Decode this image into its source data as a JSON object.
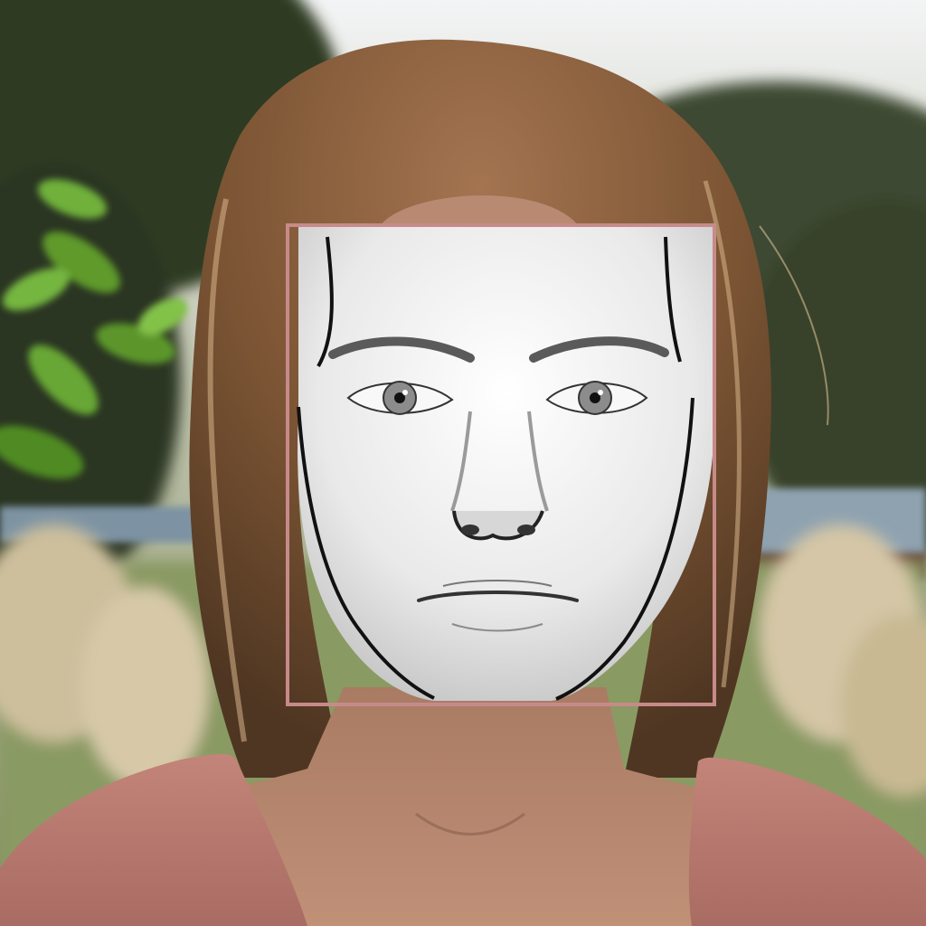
{
  "scene": {
    "subject": "portrait-with-face-detection-box",
    "colors": {
      "sky": "#e9ecef",
      "foliage_dark": "#2f3a24",
      "foliage_green": "#5f9a2c",
      "grass": "#8a9a63",
      "hair": "#8a6040",
      "hair_highlight": "#c9a77a",
      "skin": "#b98a72",
      "shirt": "#b9786d",
      "face_sketch": "#f1f1f1",
      "detection_box": "#c78a8a",
      "outline": "#111111"
    },
    "overlays": {
      "detection_box": true,
      "face_sketch_mask": true
    }
  }
}
